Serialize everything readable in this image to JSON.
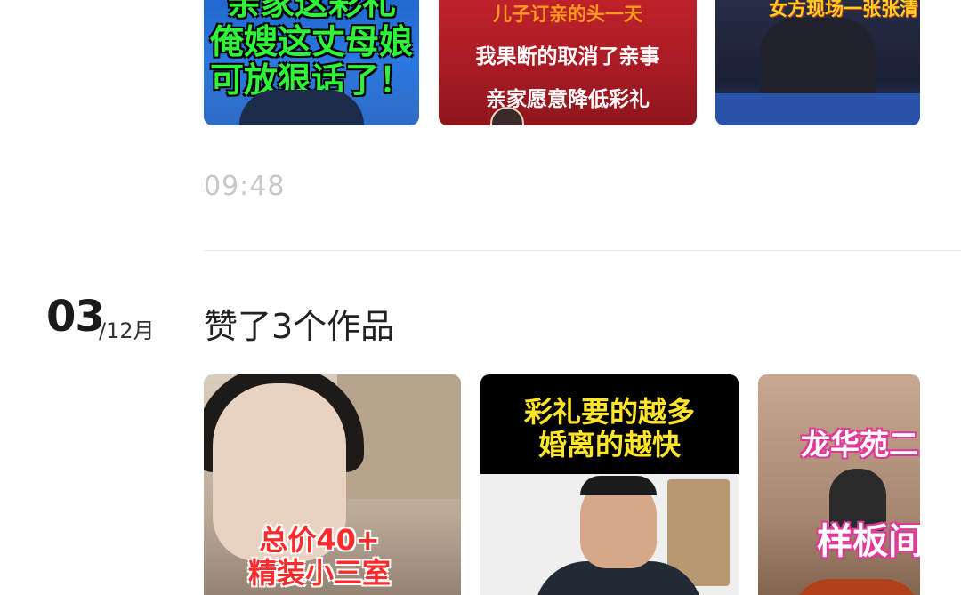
{
  "feed": {
    "previous_group": {
      "time": "09:48",
      "works": [
        {
          "caption_lines": [
            "亲家这彩礼",
            "俺嫂这丈母娘",
            "可放狠话了！"
          ]
        },
        {
          "caption_lines": [
            "儿子订亲的头一天",
            "我果断的取消了亲事",
            "亲家愿意降低彩礼"
          ]
        },
        {
          "caption_lines": [
            "女方现场一张张清"
          ]
        }
      ]
    },
    "current_group": {
      "date_day": "03",
      "date_rest": "/12月",
      "activity": "赞了3个作品",
      "works": [
        {
          "caption_lines": [
            "总价40+",
            "精装小三室"
          ]
        },
        {
          "caption_lines": [
            "彩礼要的越多",
            "婚离的越快"
          ]
        },
        {
          "caption_lines": [
            "龙华苑二",
            "样板间"
          ]
        }
      ]
    }
  }
}
